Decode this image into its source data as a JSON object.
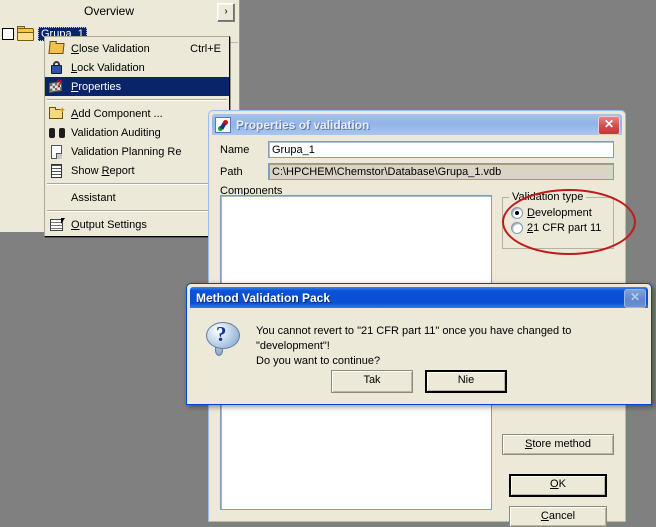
{
  "overview": {
    "title": "Overview",
    "expand_label": "›",
    "tree_item_label": "Grupa_1",
    "folder_icon": "folder-icon",
    "checkbox_name": "tree-checkbox"
  },
  "context_menu": {
    "items": [
      {
        "label": "Close Validation",
        "accel": "Ctrl+E",
        "icon": "open-folder-icon",
        "mnemonic": "C",
        "selected": false
      },
      {
        "label": "Lock Validation",
        "accel": "",
        "icon": "padlock-icon",
        "mnemonic": "L",
        "selected": false
      },
      {
        "label": "Properties",
        "accel": "",
        "icon": "checkered-flag-question-icon",
        "mnemonic": "P",
        "selected": true
      },
      {
        "separator": true
      },
      {
        "label": "Add Component ...",
        "accel": "",
        "icon": "new-folder-icon",
        "mnemonic": "A",
        "selected": false
      },
      {
        "label": "Validation Auditing",
        "accel": "",
        "icon": "binoculars-icon",
        "mnemonic": "",
        "selected": false
      },
      {
        "label": "Validation Planning Re",
        "accel": "",
        "icon": "document-icon",
        "mnemonic": "",
        "selected": false
      },
      {
        "label": "Show Report",
        "accel": "",
        "icon": "report-icon",
        "mnemonic": "R",
        "selected": false
      },
      {
        "separator": true
      },
      {
        "label": "Assistant",
        "accel": "",
        "icon": "",
        "mnemonic": "",
        "selected": false
      },
      {
        "separator": true
      },
      {
        "label": "Output Settings",
        "accel": "",
        "icon": "properties-icon",
        "mnemonic": "O",
        "selected": false
      }
    ]
  },
  "properties_dialog": {
    "title": "Properties of validation",
    "app_icon": "validation-app-icon",
    "close_label": "✕",
    "name_label": "Name",
    "name_value": "Grupa_1",
    "path_label": "Path",
    "path_value": "C:\\HPCHEM\\Chemstor\\Database\\Grupa_1.vdb",
    "components_label": "Components",
    "components_items": [],
    "validation_type": {
      "legend": "Validation type",
      "options": [
        {
          "label": "Development",
          "checked": true
        },
        {
          "label": "21 CFR part 11",
          "checked": false
        }
      ]
    },
    "buttons": {
      "store_method": "Store method",
      "ok": "OK",
      "cancel": "Cancel"
    }
  },
  "message_box": {
    "title": "Method Validation Pack",
    "close_label": "✕",
    "icon": "question-icon",
    "line1": "You cannot revert to \"21 CFR part 11\" once you have changed to \"development\"!",
    "line2": "Do you want to continue?",
    "buttons": {
      "yes": "Tak",
      "no": "Nie"
    }
  },
  "annotation": {
    "shape": "ellipse",
    "color": "#c21a1a",
    "target": "validation-type-group"
  },
  "colors": {
    "desktop_background": "#808080",
    "dialog_face": "#ece9d8",
    "selection_blue": "#0a246a",
    "active_titlebar": "#0a52d8",
    "inactive_titlebar": "#8fb3e8",
    "annotation_red": "#c21a1a"
  }
}
